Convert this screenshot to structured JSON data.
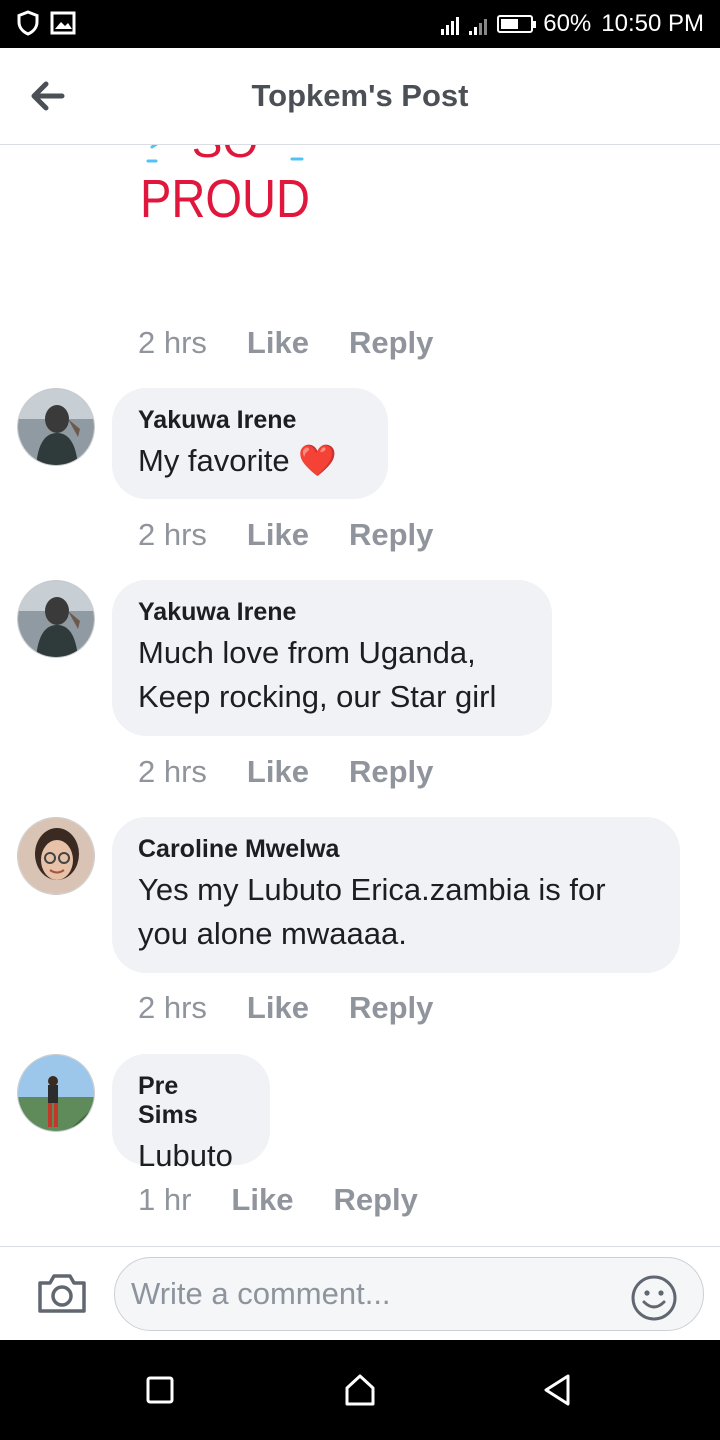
{
  "status_bar": {
    "battery": "60%",
    "time": "10:50 PM",
    "battery_level": 0.6
  },
  "header": {
    "title": "Topkem's Post"
  },
  "sticker": {
    "line1": "SO",
    "line2": "PROUD"
  },
  "comments": [
    {
      "time": "2 hrs",
      "like": "Like",
      "reply": "Reply"
    },
    {
      "author": "Yakuwa Irene",
      "text": "My favorite ❤️",
      "time": "2 hrs",
      "like": "Like",
      "reply": "Reply"
    },
    {
      "author": "Yakuwa Irene",
      "text": "Much love from Uganda, Keep rocking, our Star girl",
      "time": "2 hrs",
      "like": "Like",
      "reply": "Reply"
    },
    {
      "author": "Caroline Mwelwa",
      "text": "Yes my Lubuto Erica.zambia is for you alone mwaaaa.",
      "time": "2 hrs",
      "like": "Like",
      "reply": "Reply"
    },
    {
      "author": "Pre Sims",
      "text": "Lubuto",
      "time": "1 hr",
      "like": "Like",
      "reply": "Reply"
    }
  ],
  "composer": {
    "placeholder": "Write a comment..."
  },
  "colors": {
    "sticker_red": "#e0163c",
    "sticker_blue": "#4fc3f7",
    "bubble_bg": "#f0f2f5",
    "meta_gray": "#90949c"
  }
}
